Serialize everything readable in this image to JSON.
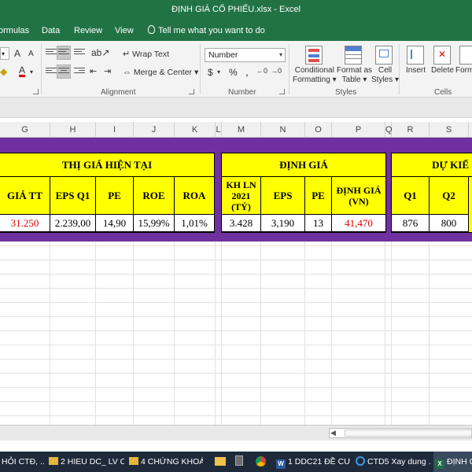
{
  "window": {
    "title": "ĐỊNH GIÁ CỔ PHIẾU.xlsx - Excel"
  },
  "ribbon_tabs": [
    "ormulas",
    "Data",
    "Review",
    "View"
  ],
  "tell_me": "Tell me what you want to do",
  "ribbon": {
    "font_grow": "A",
    "font_shrink": "A",
    "font_color": "A",
    "wrap_text": "Wrap Text",
    "merge_center": "Merge & Center",
    "alignment_label": "Alignment",
    "number_format": "Number",
    "currency": "$",
    "percent": "%",
    "comma": ",",
    "number_label": "Number",
    "conditional_formatting": [
      "Conditional",
      "Formatting ▾"
    ],
    "format_as_table": [
      "Format as",
      "Table ▾"
    ],
    "cell_styles": [
      "Cell",
      "Styles ▾"
    ],
    "styles_label": "Styles",
    "insert": "Insert",
    "delete": "Delete",
    "format": "Form",
    "cells_label": "Cells"
  },
  "columns": [
    "G",
    "H",
    "I",
    "J",
    "K",
    "L",
    "M",
    "N",
    "O",
    "P",
    "Q",
    "R",
    "S"
  ],
  "sheet": {
    "thi_gia": {
      "header": "THỊ GIÁ HIỆN TẠI",
      "cols": [
        "GIÁ TT",
        "EPS Q1",
        "PE",
        "ROE",
        "ROA"
      ],
      "values": [
        "31.250",
        "2.239,00",
        "14,90",
        "15,99%",
        "1,01%"
      ]
    },
    "dinh_gia": {
      "header": "ĐỊNH GIÁ",
      "cols": [
        "KH LN 2021 (TỶ)",
        "EPS",
        "PE",
        "ĐỊNH GIÁ (VN)"
      ],
      "values": [
        "3.428",
        "3,190",
        "13",
        "41,470"
      ]
    },
    "du_kien": {
      "header": "DỰ KIẾ",
      "cols": [
        "Q1",
        "Q2"
      ],
      "values": [
        "876",
        "800"
      ]
    }
  },
  "taskbar": [
    {
      "label": "HỎI CTĐ, ..."
    },
    {
      "label": "2 HIEU DC_ LV C..."
    },
    {
      "label": "4 CHỨNG KHOÁN"
    },
    {
      "label": "1 DDC21 ĐỀ CƯ..."
    },
    {
      "label": "CTD5 Xay dung ..."
    },
    {
      "label": "ĐỊNH G"
    }
  ],
  "colors": {
    "excel_green": "#217346",
    "band_purple": "#7030a0",
    "table_yellow": "#ffff00",
    "value_red": "#e00000"
  }
}
